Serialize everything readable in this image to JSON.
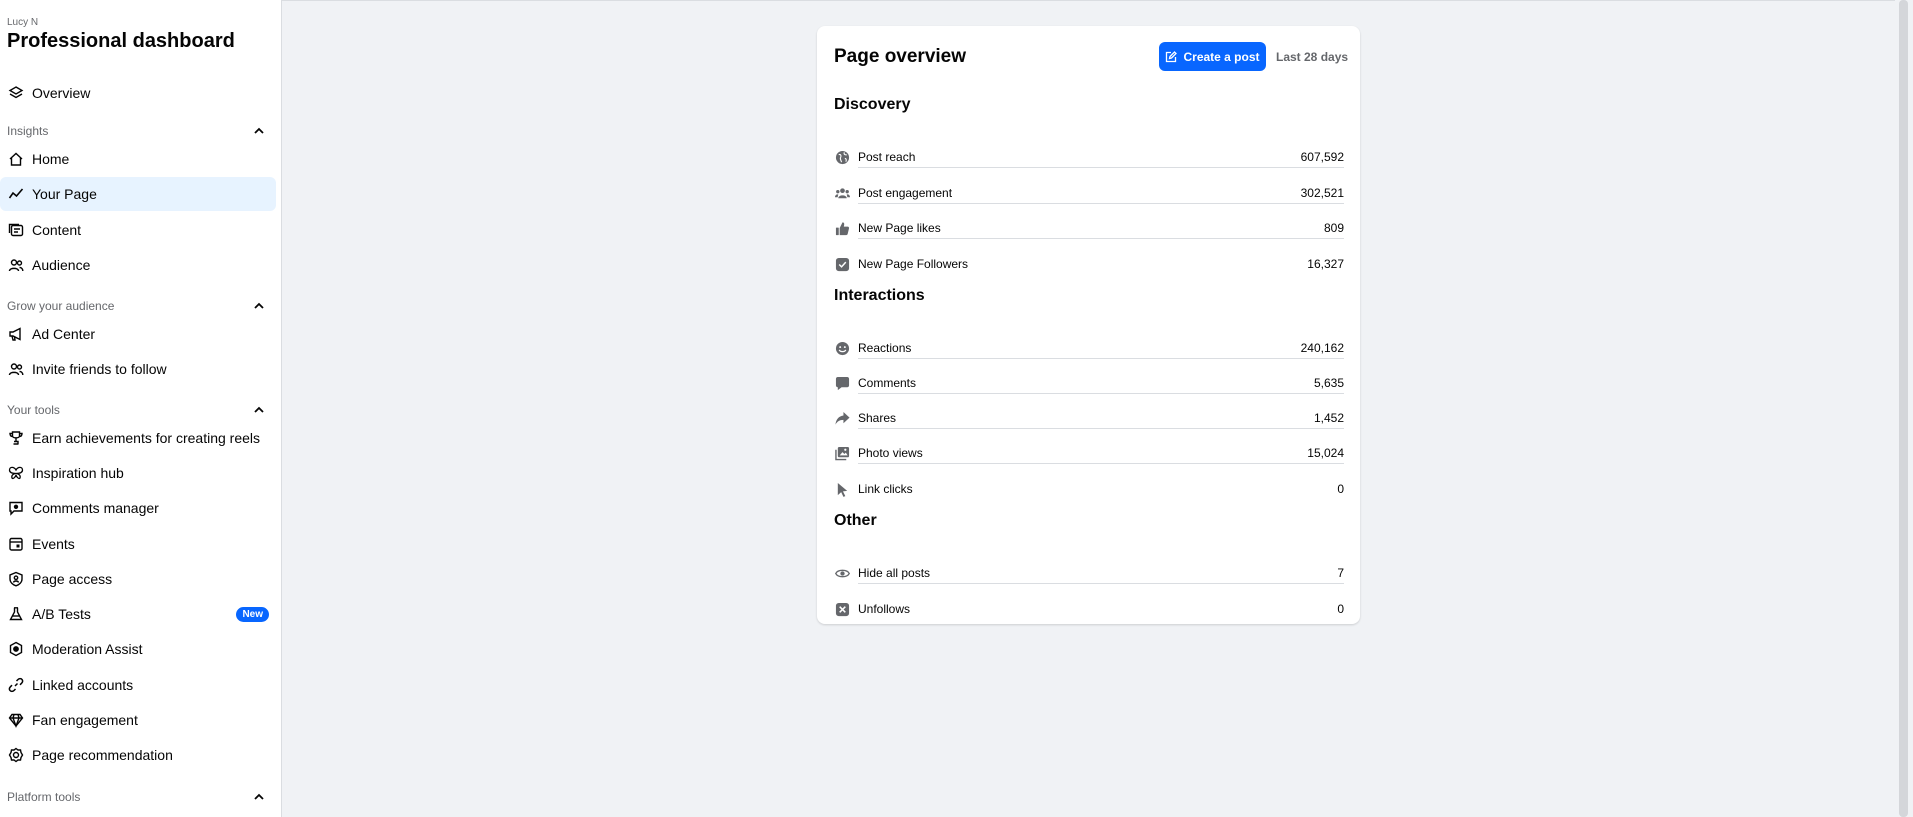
{
  "sidebar": {
    "user": "Lucy N",
    "title": "Professional dashboard",
    "overview": "Overview",
    "insights": {
      "label": "Insights",
      "items": [
        "Home",
        "Your Page",
        "Content",
        "Audience"
      ]
    },
    "grow": {
      "label": "Grow your audience",
      "items": [
        "Ad Center",
        "Invite friends to follow"
      ]
    },
    "tools": {
      "label": "Your tools",
      "items": [
        "Earn achievements for creating reels",
        "Inspiration hub",
        "Comments manager",
        "Events",
        "Page access",
        "A/B Tests",
        "Moderation Assist",
        "Linked accounts",
        "Fan engagement",
        "Page recommendation"
      ],
      "badge": "New"
    },
    "platform": {
      "label": "Platform tools"
    }
  },
  "card": {
    "title": "Page overview",
    "create_label": "Create a post",
    "range": "Last 28 days",
    "discovery": {
      "title": "Discovery",
      "rows": [
        {
          "label": "Post reach",
          "value": "607,592",
          "icon": "globe-icon"
        },
        {
          "label": "Post engagement",
          "value": "302,521",
          "icon": "people-icon"
        },
        {
          "label": "New Page likes",
          "value": "809",
          "icon": "thumbs-up-icon"
        },
        {
          "label": "New Page Followers",
          "value": "16,327",
          "icon": "follower-check-icon"
        }
      ]
    },
    "interactions": {
      "title": "Interactions",
      "rows": [
        {
          "label": "Reactions",
          "value": "240,162",
          "icon": "smiley-icon"
        },
        {
          "label": "Comments",
          "value": "5,635",
          "icon": "comment-icon"
        },
        {
          "label": "Shares",
          "value": "1,452",
          "icon": "share-icon"
        },
        {
          "label": "Photo views",
          "value": "15,024",
          "icon": "photo-icon"
        },
        {
          "label": "Link clicks",
          "value": "0",
          "icon": "cursor-icon"
        }
      ]
    },
    "other": {
      "title": "Other",
      "rows": [
        {
          "label": "Hide all posts",
          "value": "7",
          "icon": "eye-icon"
        },
        {
          "label": "Unfollows",
          "value": "0",
          "icon": "unfollow-icon"
        }
      ]
    }
  },
  "colors": {
    "accent": "#0866ff",
    "active_bg": "#e7f3ff",
    "page_bg": "#f0f2f5"
  }
}
